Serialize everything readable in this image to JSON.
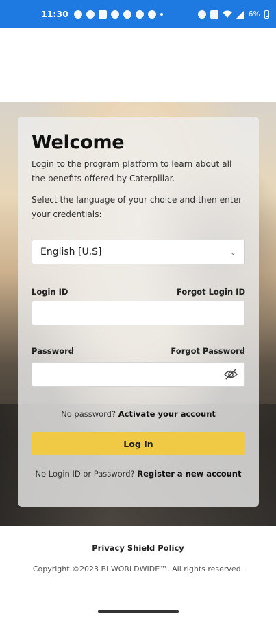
{
  "status_bar": {
    "time": "11:30",
    "battery": "6%",
    "icons": [
      "whatsapp-icon",
      "chat-icon",
      "instagram-icon",
      "k-icon",
      "threads-icon",
      "messenger-icon",
      "bulb-icon",
      "dot-icon",
      "alarm-icon",
      "photo-icon",
      "wifi-icon",
      "signal-icon",
      "battery-icon"
    ]
  },
  "card": {
    "title": "Welcome",
    "intro": "Login to the program platform to learn about all the benefits offered by Caterpillar.",
    "instruction": "Select the language of your choice and then enter your credentials:",
    "language_select": {
      "value": "English [U.S]"
    },
    "login_id_label": "Login ID",
    "forgot_login_id": "Forgot Login ID",
    "password_label": "Password",
    "forgot_password": "Forgot Password",
    "no_password_text": "No password?",
    "activate_link": "Activate your account",
    "login_button": "Log In",
    "no_login_text": "No Login ID or Password?",
    "register_link": "Register a new account"
  },
  "footer": {
    "privacy": "Privacy Shield Policy",
    "copyright": "Copyright ©2023 BI WORLDWIDE™. All rights reserved."
  },
  "colors": {
    "status_bar": "#1e7ae0",
    "login_button": "#f0ca45"
  }
}
